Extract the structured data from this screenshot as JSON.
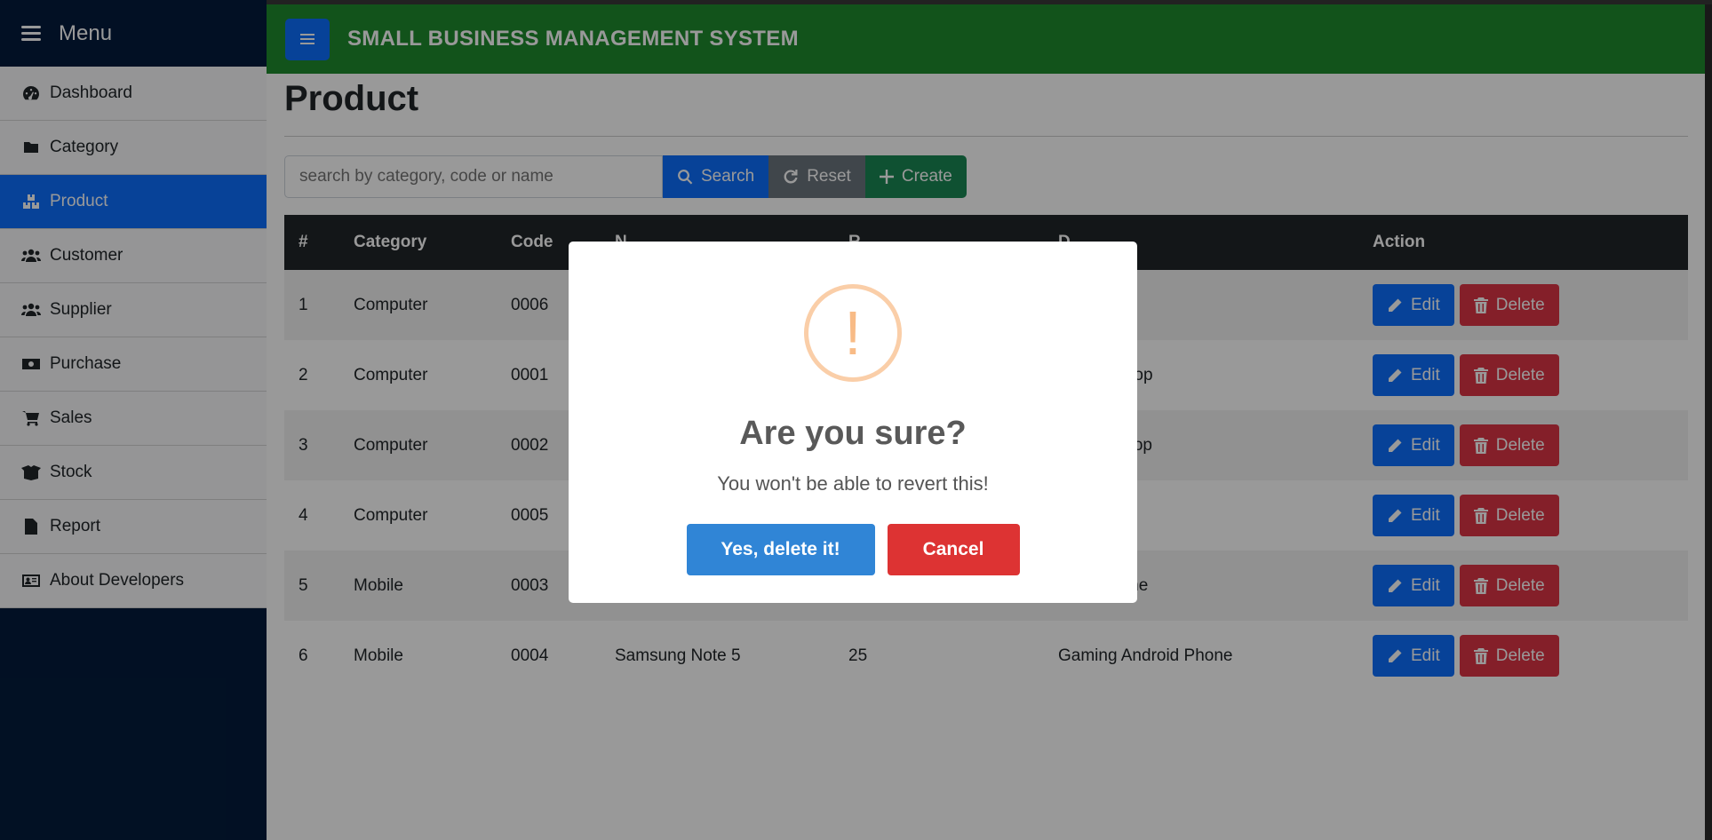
{
  "sidebar": {
    "menu_label": "Menu",
    "items": [
      {
        "label": "Dashboard",
        "icon": "gauge-icon"
      },
      {
        "label": "Category",
        "icon": "folder-icon"
      },
      {
        "label": "Product",
        "icon": "boxes-icon",
        "active": true
      },
      {
        "label": "Customer",
        "icon": "users-icon"
      },
      {
        "label": "Supplier",
        "icon": "users-icon"
      },
      {
        "label": "Purchase",
        "icon": "money-icon"
      },
      {
        "label": "Sales",
        "icon": "cart-icon"
      },
      {
        "label": "Stock",
        "icon": "box-open-icon"
      },
      {
        "label": "Report",
        "icon": "file-icon"
      },
      {
        "label": "About Developers",
        "icon": "id-card-icon"
      }
    ]
  },
  "header": {
    "title": "SMALL BUSINESS MANAGEMENT SYSTEM"
  },
  "main": {
    "page_title": "Product",
    "search": {
      "placeholder": "search by category, code or name",
      "search_label": "Search",
      "reset_label": "Reset",
      "create_label": "Create"
    },
    "table": {
      "headers": [
        "#",
        "Category",
        "Code",
        "N",
        "R",
        "D",
        "Action"
      ],
      "rows": [
        {
          "num": "1",
          "category": "Computer",
          "code": "0006",
          "name": "",
          "reorder": "",
          "description": ""
        },
        {
          "num": "2",
          "category": "Computer",
          "code": "0001",
          "name": "",
          "reorder": "",
          "description": "aptop"
        },
        {
          "num": "3",
          "category": "Computer",
          "code": "0002",
          "name": "",
          "reorder": "",
          "description": "ptop"
        },
        {
          "num": "4",
          "category": "Computer",
          "code": "0005",
          "name": "",
          "reorder": "",
          "description": ""
        },
        {
          "num": "5",
          "category": "Mobile",
          "code": "0003",
          "name": "",
          "reorder": "",
          "description": "hone"
        },
        {
          "num": "6",
          "category": "Mobile",
          "code": "0004",
          "name": "Samsung Note 5",
          "reorder": "25",
          "description": "Gaming Android Phone"
        }
      ],
      "edit_label": "Edit",
      "delete_label": "Delete"
    }
  },
  "modal": {
    "icon": "!",
    "title": "Are you sure?",
    "text": "You won't be able to revert this!",
    "confirm_label": "Yes, delete it!",
    "cancel_label": "Cancel"
  },
  "colors": {
    "sidebar": "#041c3c",
    "header": "#1f8a2e",
    "primary": "#0d6efd",
    "danger": "#dc3545",
    "confirm": "#3085d6",
    "cancel": "#dd3333",
    "warning_ring": "#facea8"
  }
}
